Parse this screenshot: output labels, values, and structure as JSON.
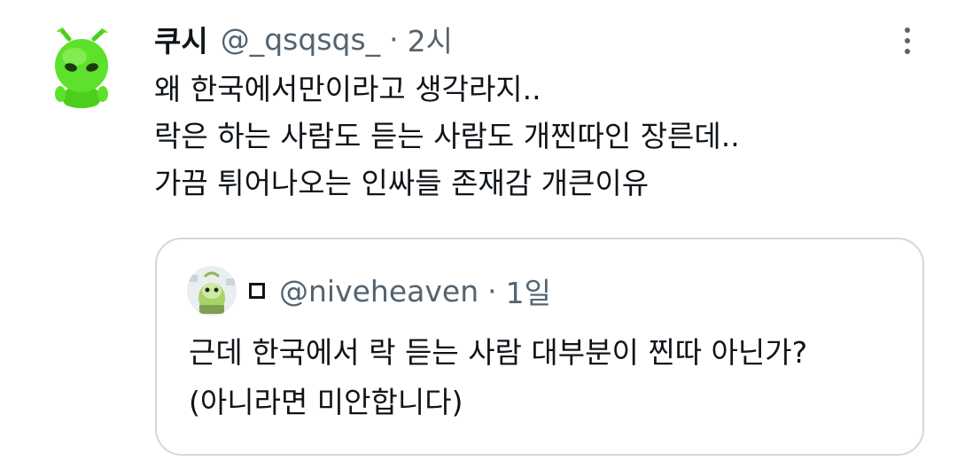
{
  "tweet": {
    "display_name": "쿠시",
    "handle": "@_qsqsqs_",
    "separator": "·",
    "time": "2시",
    "avatar_icon": "green-alien-avatar-icon",
    "more_icon": "more-options-icon",
    "text_lines": [
      "왜 한국에서만이라고 생각라지..",
      "락은 하는 사람도 듣는 사람도 개찐따인 장른데..",
      "가끔 튀어나오는 인싸들 존재감 개큰이유"
    ]
  },
  "quoted_tweet": {
    "display_name_icon": "box-icon",
    "handle": "@niveheaven",
    "separator": "·",
    "time": "1일",
    "avatar_icon": "green-character-avatar-icon",
    "text_lines": [
      "근데 한국에서 락 듣는 사람 대부분이 찐따 아닌가?",
      "(아니라면 미안합니다)"
    ]
  },
  "colors": {
    "text_primary": "#0f1419",
    "text_secondary": "#536471",
    "border": "#cfd9de",
    "avatar_green": "#5ee12c"
  }
}
